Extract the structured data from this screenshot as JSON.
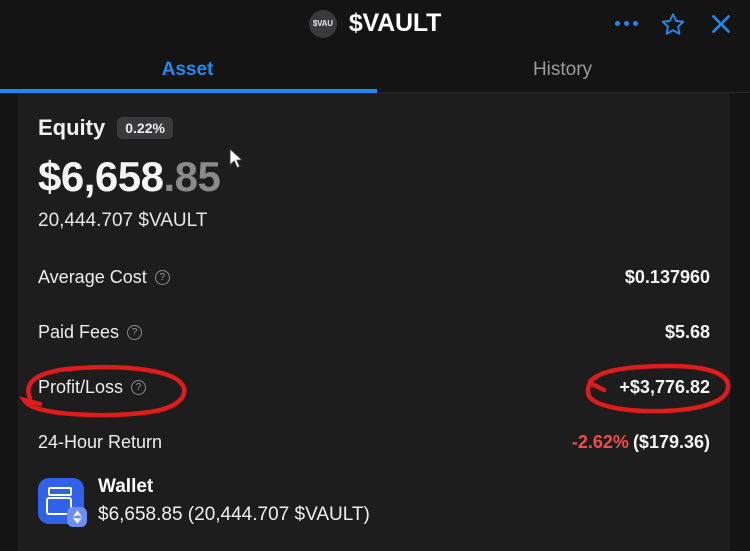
{
  "header": {
    "avatar_text": "$VAU",
    "avatar_icon": "token-avatar-icon",
    "title": "$VAULT",
    "actions": [
      {
        "name": "more-options-icon",
        "label": "..."
      },
      {
        "name": "favorite-star-icon",
        "label": "☆"
      },
      {
        "name": "close-icon",
        "label": "✕"
      }
    ]
  },
  "tabs": [
    {
      "label": "Asset",
      "active": true
    },
    {
      "label": "History",
      "active": false
    }
  ],
  "equity": {
    "label": "Equity",
    "badge": "0.22%",
    "balance_whole": "$6,658",
    "balance_cents": ".85",
    "balance_tokens": "20,444.707 $VAULT"
  },
  "stats": [
    {
      "label": "Average Cost",
      "help": "?",
      "value": "$0.137960",
      "value_secondary": "",
      "negative": false
    },
    {
      "label": "Paid Fees",
      "help": "?",
      "value": "$5.68",
      "value_secondary": "",
      "negative": false
    },
    {
      "label": "Profit/Loss",
      "help": "?",
      "value": "+$3,776.82",
      "value_secondary": "",
      "negative": false
    },
    {
      "label": "24-Hour Return",
      "help": "",
      "value": "-2.62%",
      "value_secondary": "($179.36)",
      "negative": true
    }
  ],
  "wallet": {
    "icon": "wallet-icon",
    "chain_badge": "ethereum-icon",
    "name": "Wallet",
    "amount": "$6,658.85 (20,444.707 $VAULT)"
  },
  "annotations": {
    "color": "#e01b1b",
    "items": [
      {
        "name": "profit-loss-label-circle"
      },
      {
        "name": "profit-loss-value-circle"
      }
    ]
  },
  "colors": {
    "accent": "#1d8af0",
    "negative": "#ef4c4c",
    "panel": "#1d1d1d",
    "window": "#141414",
    "wallet_blue": "#2f62e8"
  }
}
